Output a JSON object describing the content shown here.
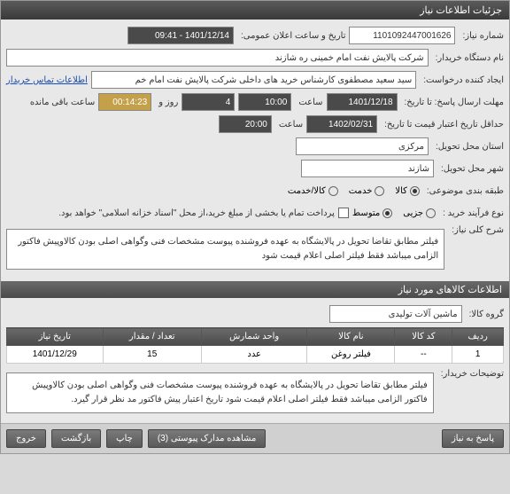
{
  "window_title": "جزئیات اطلاعات نیاز",
  "header": {
    "need_number_label": "شماره نیاز:",
    "need_number": "1101092447001626",
    "announce_label": "تاریخ و ساعت اعلان عمومی:",
    "announce_value": "1401/12/14 - 09:41",
    "org_label": "نام دستگاه خریدار:",
    "org_value": "شرکت پالایش نفت امام خمینی ره شازند",
    "requester_label": "ایجاد کننده درخواست:",
    "requester_value": "سید سعید مصطفوی کارشناس خرید های داخلی شرکت پالایش نفت امام خم",
    "contact_link": "اطلاعات تماس خریدار",
    "deadline_label": "مهلت ارسال پاسخ: تا تاریخ:",
    "deadline_date": "1401/12/18",
    "time_label": "ساعت",
    "deadline_time": "10:00",
    "days_value": "4",
    "days_label": "روز و",
    "countdown": "00:14:23",
    "remaining_label": "ساعت باقی مانده",
    "validity_label": "حداقل تاریخ اعتبار قیمت تا تاریخ:",
    "validity_date": "1402/02/31",
    "validity_time": "20:00",
    "province_label": "استان محل تحویل:",
    "province_value": "مرکزی",
    "city_label": "شهر محل تحویل:",
    "city_value": "شازند",
    "category_label": "طبقه بندی موضوعی:",
    "cat_goods": "کالا",
    "cat_service": "خدمت",
    "cat_both": "کالا/خدمت",
    "purchase_type_label": "نوع فرآیند خرید :",
    "pt_small": "جزیی",
    "pt_medium": "متوسط",
    "payment_note": "پرداخت تمام یا بخشی از مبلغ خرید،از محل \"اسناد خزانه اسلامی\" خواهد بود.",
    "desc_label": "شرح کلی نیاز:",
    "desc_text": "فیلتر مطابق تقاضا تحویل در پالایشگاه به عهده فروشنده پیوست مشخصات فنی وگواهی اصلی بودن کالاوپیش فاکتور الزامی میباشد فقط فیلتر اصلی اعلام قیمت شود"
  },
  "goods_section": {
    "title": "اطلاعات کالاهای مورد نیاز",
    "group_label": "گروه کالا:",
    "group_value": "ماشین آلات تولیدی",
    "columns": {
      "row": "ردیف",
      "code": "کد کالا",
      "name": "نام کالا",
      "unit": "واحد شمارش",
      "qty": "تعداد / مقدار",
      "date": "تاریخ نیاز"
    },
    "rows": [
      {
        "row": "1",
        "code": "--",
        "name": "فیلتر روغن",
        "unit": "عدد",
        "qty": "15",
        "date": "1401/12/29"
      }
    ],
    "buyer_notes_label": "توضیحات خریدار:",
    "buyer_notes": "فیلتر مطابق تقاضا تحویل در پالایشگاه به عهده فروشنده پیوست مشخصات فنی وگواهی اصلی بودن کالاوپیش فاکتور الزامی میباشد فقط فیلتر اصلی اعلام قیمت شود تاریخ اعتبار پیش فاکتور مد نظر قرار گیرد."
  },
  "footer": {
    "respond": "پاسخ به نیاز",
    "attachments": "مشاهده مدارک پیوستی (3)",
    "print": "چاپ",
    "back": "بازگشت",
    "exit": "خروج"
  }
}
